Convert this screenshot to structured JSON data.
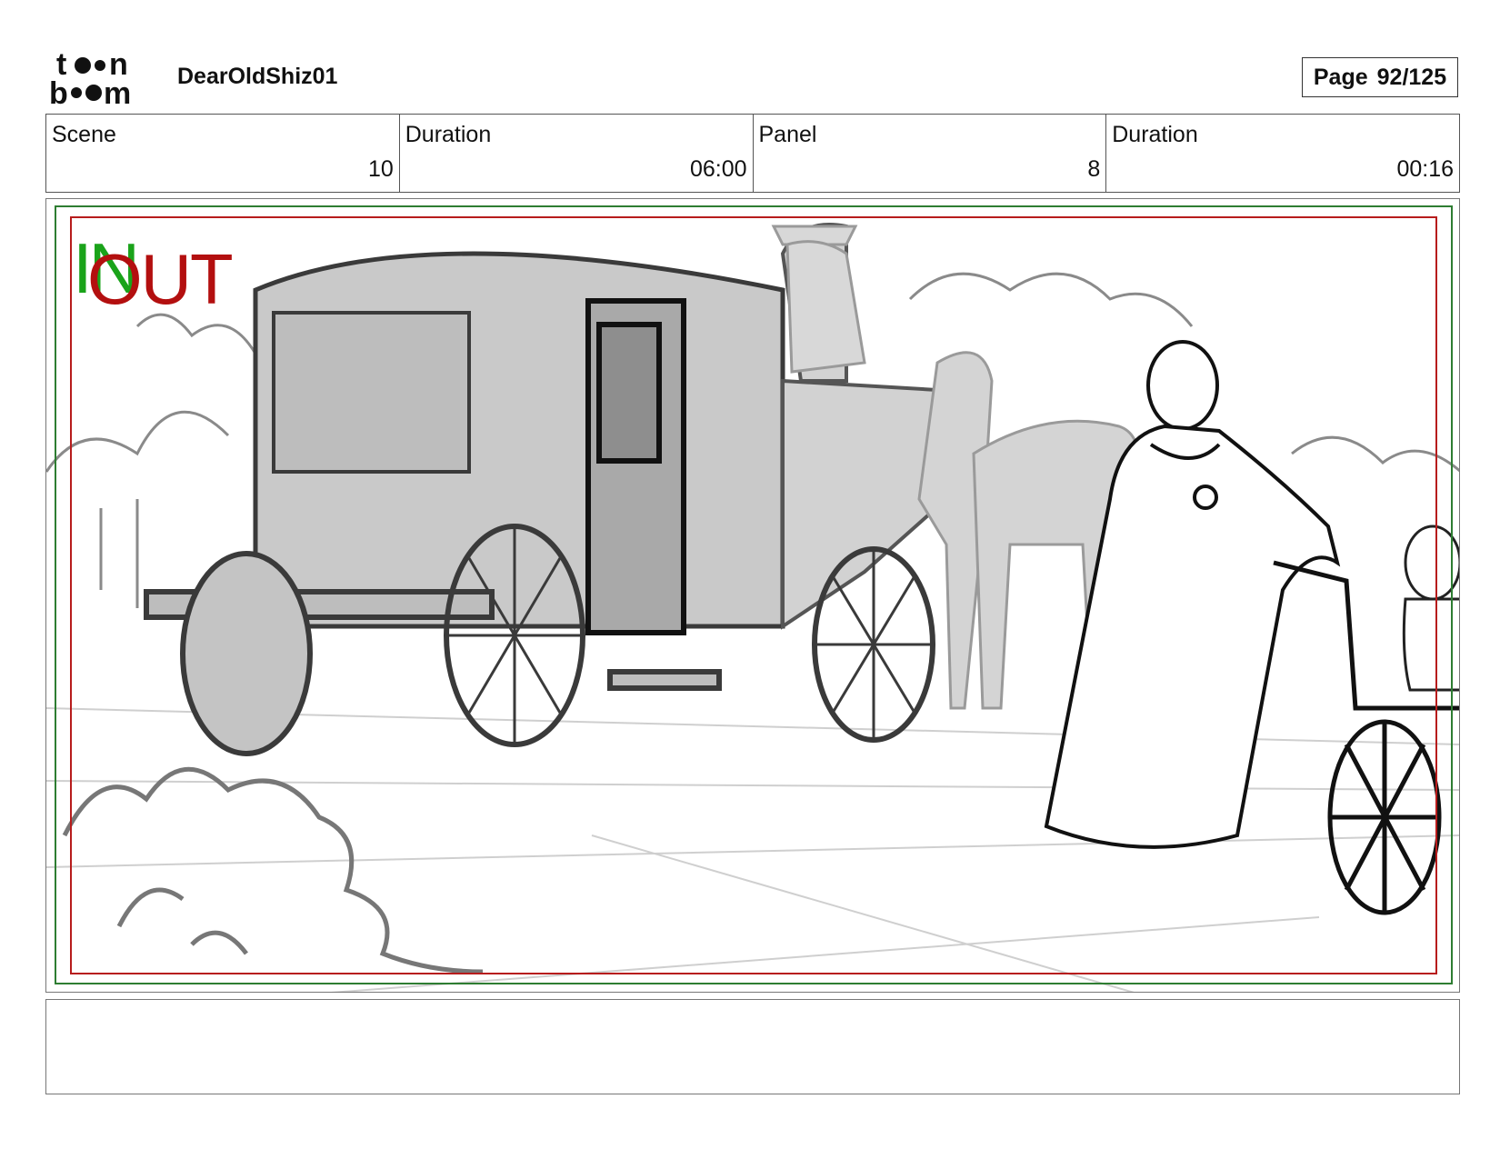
{
  "header": {
    "project_name": "DearOldShiz01",
    "page_label": "Page",
    "page_number": "92/125",
    "logo": "toon-boom-logo"
  },
  "info": [
    {
      "label": "Scene",
      "value": "10"
    },
    {
      "label": "Duration",
      "value": "06:00"
    },
    {
      "label": "Panel",
      "value": "8"
    },
    {
      "label": "Duration",
      "value": "00:16"
    }
  ],
  "panel": {
    "marker_in": "IN",
    "marker_out": "OUT",
    "colors": {
      "safe_frame": "#2e7d32",
      "action_frame": "#b71c1c",
      "in_marker": "#1aa31a",
      "out_marker": "#b30f0f"
    },
    "sketch": "carriage-with-horses-and-characters-sketch"
  },
  "notes": {
    "text": ""
  }
}
